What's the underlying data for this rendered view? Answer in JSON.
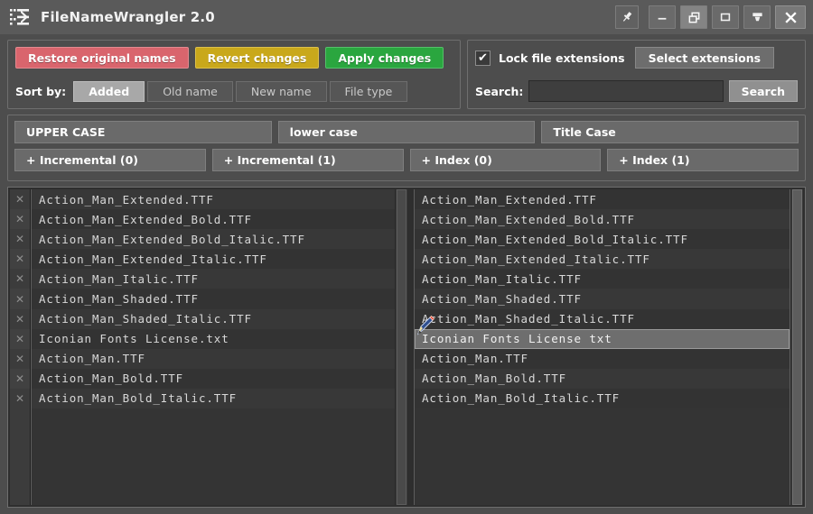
{
  "window": {
    "title": "FileNameWrangler 2.0",
    "icon": "shuffle-app-icon",
    "controls": [
      {
        "name": "pin-button",
        "glyph": "pin"
      },
      {
        "name": "minimize-button",
        "glyph": "minimize"
      },
      {
        "name": "restore-button",
        "glyph": "restore"
      },
      {
        "name": "maximize-button",
        "glyph": "maximize"
      },
      {
        "name": "rollup-button",
        "glyph": "rollup"
      },
      {
        "name": "close-button",
        "glyph": "close"
      }
    ]
  },
  "toolbar": {
    "restore_label": "Restore original names",
    "revert_label": "Revert changes",
    "apply_label": "Apply changes",
    "sort_label": "Sort by:",
    "sort_options": [
      "Added",
      "Old name",
      "New name",
      "File type"
    ],
    "sort_selected": "Added",
    "colors": {
      "restore": "#d9656d",
      "revert": "#c9a81b",
      "apply": "#2aa63f"
    }
  },
  "options": {
    "lock_extensions_label": "Lock file extensions",
    "lock_extensions_checked": true,
    "check_glyph": "✔",
    "select_extensions_label": "Select extensions",
    "search_label": "Search:",
    "search_value": "",
    "search_placeholder": "",
    "search_button_label": "Search"
  },
  "case_tools": {
    "row1": [
      "UPPER CASE",
      "lower case",
      "Title Case"
    ],
    "row2": [
      "+ Incremental (0)",
      "+ Incremental (1)",
      "+ Index (0)",
      "+ Index (1)"
    ]
  },
  "lists": {
    "remove_glyph": "✕",
    "old_names": [
      "Action_Man_Extended.TTF",
      "Action_Man_Extended_Bold.TTF",
      "Action_Man_Extended_Bold_Italic.TTF",
      "Action_Man_Extended_Italic.TTF",
      "Action_Man_Italic.TTF",
      "Action_Man_Shaded.TTF",
      "Action_Man_Shaded_Italic.TTF",
      "Iconian Fonts License.txt",
      "Action_Man.TTF",
      "Action_Man_Bold.TTF",
      "Action_Man_Bold_Italic.TTF"
    ],
    "new_names": [
      "Action_Man_Extended.TTF",
      "Action_Man_Extended_Bold.TTF",
      "Action_Man_Extended_Bold_Italic.TTF",
      "Action_Man_Extended_Italic.TTF",
      "Action_Man_Italic.TTF",
      "Action_Man_Shaded.TTF",
      "Action_Man_Shaded_Italic.TTF",
      "Iconian Fonts License txt",
      "Action_Man.TTF",
      "Action_Man_Bold.TTF",
      "Action_Man_Bold_Italic.TTF"
    ],
    "selected_index": 7,
    "cursor": "pencil-cursor"
  }
}
